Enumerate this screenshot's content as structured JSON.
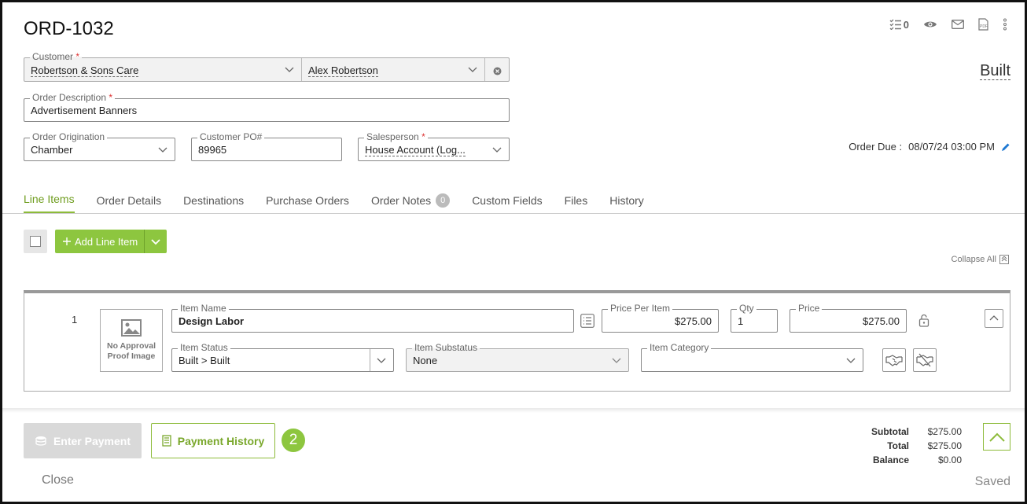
{
  "order": {
    "title": "ORD-1032",
    "status": "Built",
    "checklist_count": "0",
    "pdf_label": "PDF",
    "due_label": "Order Due :",
    "due_value": "08/07/24 03:00 PM"
  },
  "form": {
    "customer_label": "Customer",
    "customer_value": "Robertson & Sons Care",
    "contact_value": "Alex Robertson",
    "description_label": "Order Description",
    "description_value": "Advertisement Banners",
    "origination_label": "Order Origination",
    "origination_value": "Chamber",
    "po_label": "Customer PO#",
    "po_value": "89965",
    "salesperson_label": "Salesperson",
    "salesperson_value": "House Account (Log...",
    "required_mark": "*"
  },
  "tabs": [
    {
      "label": "Line Items"
    },
    {
      "label": "Order Details"
    },
    {
      "label": "Destinations"
    },
    {
      "label": "Purchase Orders"
    },
    {
      "label": "Order Notes",
      "badge": "0"
    },
    {
      "label": "Custom Fields"
    },
    {
      "label": "Files"
    },
    {
      "label": "History"
    }
  ],
  "toolbar": {
    "add_line_item_label": "Add Line Item",
    "collapse_all_label": "Collapse All"
  },
  "line_item": {
    "number": "1",
    "proof_image_text": "No Approval Proof Image",
    "item_name_label": "Item Name",
    "item_name_value": "Design Labor",
    "price_per_item_label": "Price Per Item",
    "price_per_item_value": "$275.00",
    "qty_label": "Qty",
    "qty_value": "1",
    "price_label": "Price",
    "price_value": "$275.00",
    "item_status_label": "Item Status",
    "item_status_value": "Built > Built",
    "item_substatus_label": "Item Substatus",
    "item_substatus_value": "None",
    "item_category_label": "Item Category",
    "item_category_value": ""
  },
  "footer": {
    "enter_payment_label": "Enter Payment",
    "payment_history_label": "Payment History",
    "step_badge": "2",
    "subtotal_label": "Subtotal",
    "subtotal_value": "$275.00",
    "total_label": "Total",
    "total_value": "$275.00",
    "balance_label": "Balance",
    "balance_value": "$0.00",
    "close_label": "Close",
    "saved_label": "Saved"
  },
  "colors": {
    "accent": "#8dc63f",
    "accent_text": "#6f9d1f",
    "required": "#dd3333",
    "edit_icon": "#1e78d2"
  }
}
